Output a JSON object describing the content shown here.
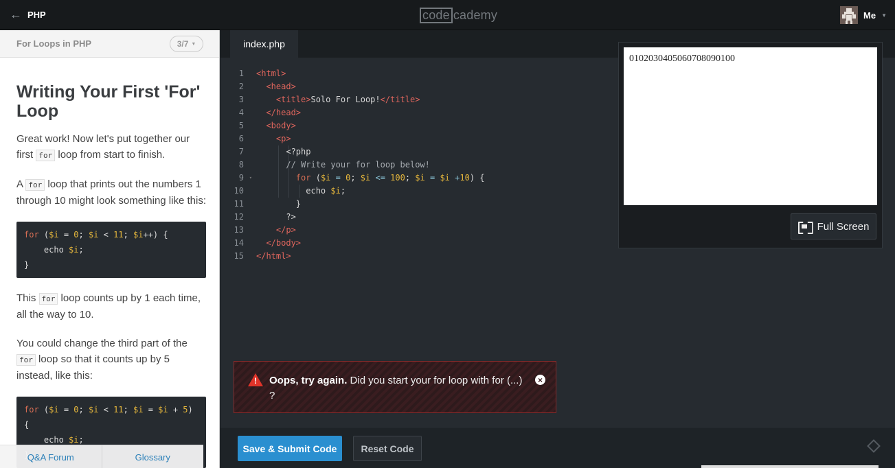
{
  "topbar": {
    "back_label": "PHP",
    "logo_box": "code",
    "logo_rest": "cademy",
    "user_name": "Me"
  },
  "lesson": {
    "header_title": "For Loops in PHP",
    "progress": "3/7",
    "heading": "Writing Your First 'For' Loop",
    "p1_before": "Great work! Now let's put together our first ",
    "p1_code": "for",
    "p1_after": " loop from start to finish.",
    "p2_before": "A ",
    "p2_code": "for",
    "p2_after": " loop that prints out the numbers 1 through 10 might look something like this:",
    "p3_before": "This ",
    "p3_code": "for",
    "p3_after": " loop counts up by 1 each time, all the way to 10.",
    "p4_before": "You could change the third part of the ",
    "p4_code": "for",
    "p4_after": " loop so that it counts up by 5 instead, like this:",
    "footer_links": [
      "Q&A Forum",
      "Glossary"
    ]
  },
  "editor": {
    "tab_label": "index.php",
    "line_numbers": [
      "1",
      "2",
      "3",
      "4",
      "5",
      "6",
      "7",
      "8",
      "9",
      "10",
      "11",
      "12",
      "13",
      "14",
      "15"
    ]
  },
  "output": {
    "text": "0102030405060708090100",
    "fullscreen_label": "Full Screen"
  },
  "error": {
    "bold": "Oops, try again.",
    "message": " Did you start your for loop with for (...) ?"
  },
  "bottombar": {
    "submit_label": "Save & Submit Code",
    "reset_label": "Reset Code"
  },
  "colors": {
    "accent": "#2a8fd0",
    "error": "#e0342a",
    "editor_bg": "#262b30"
  }
}
